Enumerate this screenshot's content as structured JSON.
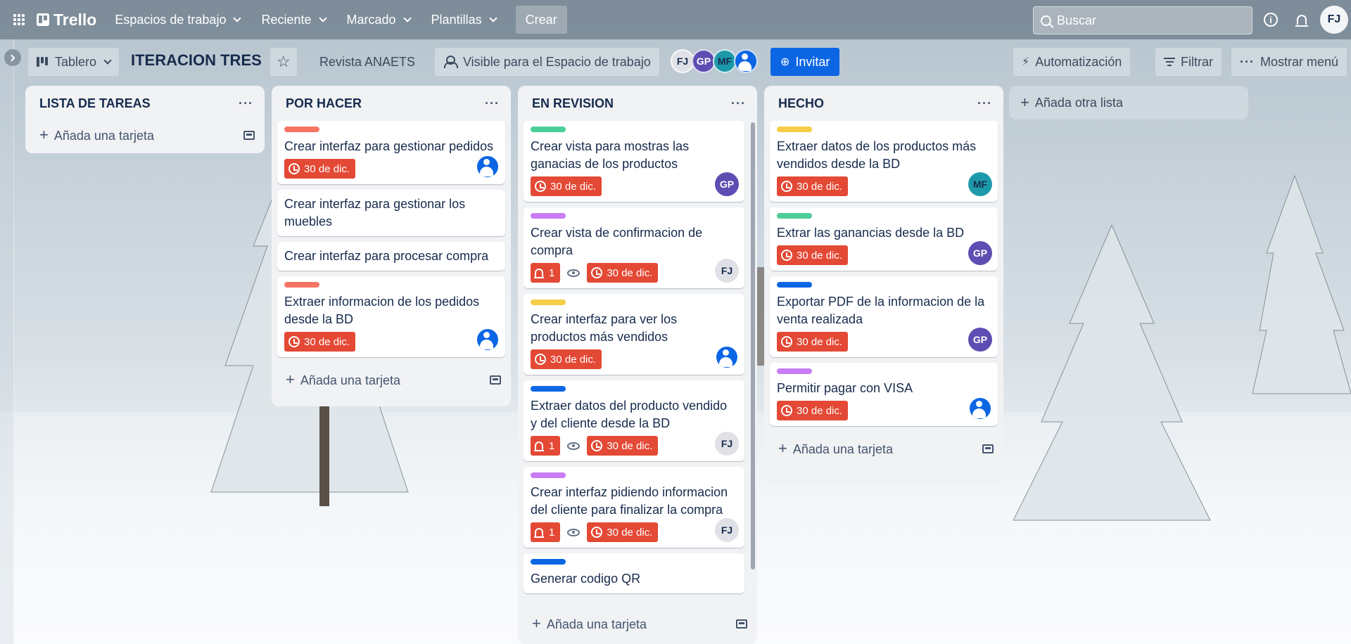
{
  "topbar": {
    "logo": "Trello",
    "nav": [
      "Espacios de trabajo",
      "Reciente",
      "Marcado",
      "Plantillas"
    ],
    "create": "Crear",
    "search_placeholder": "Buscar",
    "user_initials": "FJ"
  },
  "board": {
    "view": "Tablero",
    "title": "ITERACION TRES",
    "workspace": "Revista ANAETS",
    "visibility": "Visible para el Espacio de trabajo",
    "members": [
      "FJ",
      "GP",
      "MF",
      ""
    ],
    "invite": "Invitar",
    "automation": "Automatización",
    "filter": "Filtrar",
    "menu": "Mostrar menú",
    "add_list": "Añada otra lista",
    "add_card": "Añada una tarjeta"
  },
  "colors": {
    "due_red": "#e34935",
    "label_red": "#f87462",
    "label_green": "#4bce97",
    "label_yellow": "#f5cd47",
    "label_purple": "#c97cf4",
    "label_blue": "#0c66e4"
  },
  "lists": [
    {
      "title": "LISTA DE TAREAS",
      "cards": []
    },
    {
      "title": "POR HACER",
      "cards": [
        {
          "label": "red",
          "title": "Crear interfaz para gestionar pedidos",
          "due": "30 de dic.",
          "member": "anon"
        },
        {
          "label": "",
          "title": "Crear interfaz para gestionar los muebles",
          "due": "",
          "member": ""
        },
        {
          "label": "",
          "title": "Crear interfaz para procesar compra",
          "due": "",
          "member": ""
        },
        {
          "label": "red",
          "title": "Extraer informacion de los pedidos desde la BD",
          "due": "30 de dic.",
          "member": "anon"
        }
      ]
    },
    {
      "title": "EN REVISION",
      "cards": [
        {
          "label": "green",
          "title": "Crear vista para mostras las ganacias de los productos",
          "due": "30 de dic.",
          "member": "GP"
        },
        {
          "label": "purple",
          "title": "Crear vista de confirmacion de compra",
          "notif": "1",
          "due": "30 de dic.",
          "member": "FJ"
        },
        {
          "label": "yellow",
          "title": "Crear interfaz para ver los productos más vendidos",
          "due": "30 de dic.",
          "member": "anon"
        },
        {
          "label": "blue",
          "title": "Extraer datos del producto vendido y del cliente desde la BD",
          "notif": "1",
          "due": "30 de dic.",
          "member": "FJ"
        },
        {
          "label": "purple",
          "title": "Crear interfaz pidiendo informacion del cliente para finalizar la compra",
          "notif": "1",
          "due": "30 de dic.",
          "member": "FJ"
        },
        {
          "label": "blue",
          "title": "Generar codigo QR",
          "due": "",
          "member": ""
        }
      ]
    },
    {
      "title": "HECHO",
      "cards": [
        {
          "label": "yellow",
          "title": "Extraer datos de los productos más vendidos desde la BD",
          "due": "30 de dic.",
          "member": "MF"
        },
        {
          "label": "green",
          "title": "Extrar las ganancias desde la BD",
          "due": "30 de dic.",
          "member": "GP"
        },
        {
          "label": "blue",
          "title": "Exportar PDF de la informacion de la venta realizada",
          "due": "30 de dic.",
          "member": "GP"
        },
        {
          "label": "purple",
          "title": "Permitir pagar con VISA",
          "due": "30 de dic.",
          "member": "anon"
        }
      ]
    }
  ]
}
